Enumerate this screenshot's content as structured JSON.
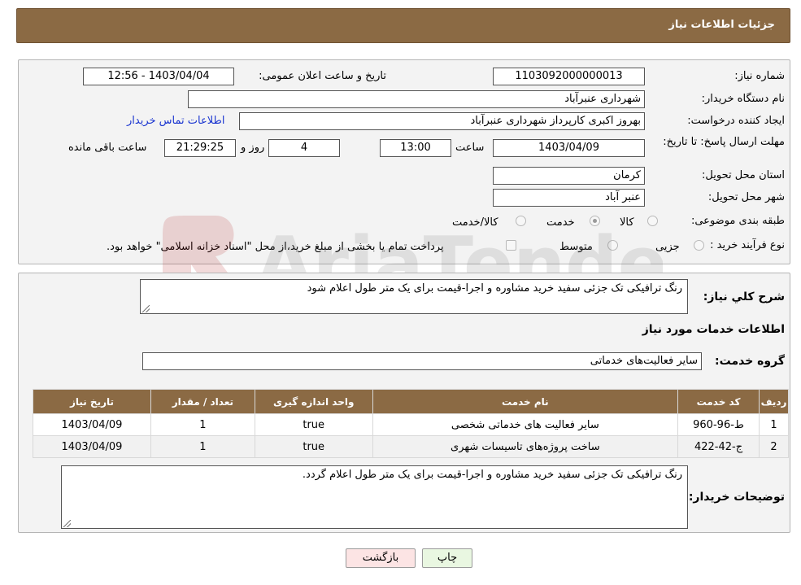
{
  "header": {
    "title": "جزئیات اطلاعات نیاز"
  },
  "form": {
    "need_number_label": "شماره نیاز:",
    "need_number": "1103092000000013",
    "announce_label": "تاریخ و ساعت اعلان عمومی:",
    "announce_value": "1403/04/04 - 12:56",
    "buyer_org_label": "نام دستگاه خریدار:",
    "buyer_org": "شهرداری عنبرآباد",
    "creator_label": "ایجاد کننده درخواست:",
    "creator": "بهروز اکبری کارپرداز شهرداری عنبرآباد",
    "contact_link": "اطلاعات تماس خریدار",
    "deadline_label": "مهلت ارسال پاسخ: تا تاریخ:",
    "deadline_date": "1403/04/09",
    "time_label": "ساعت",
    "deadline_time": "13:00",
    "days_value": "4",
    "days_label": "روز و",
    "remaining_time": "21:29:25",
    "remaining_label": "ساعت باقی مانده",
    "province_label": "استان محل تحویل:",
    "province": "کرمان",
    "city_label": "شهر محل تحویل:",
    "city": "عنبر آباد",
    "category_label": "طبقه بندی موضوعی:",
    "category_options": [
      "کالا",
      "خدمت",
      "کالا/خدمت"
    ],
    "category_selected": "خدمت",
    "process_label": "نوع فرآیند خرید :",
    "process_options": [
      "جزیی",
      "متوسط"
    ],
    "process_note": "پرداخت تمام یا بخشی از مبلغ خرید،از محل \"اسناد خزانه اسلامی\" خواهد بود."
  },
  "details": {
    "summary_label": "شرح کلي نياز:",
    "summary": "رنگ ترافیکی تک جزئی سفید خرید مشاوره و اجرا-قیمت برای یک متر طول اعلام شود",
    "services_title": "اطلاعات خدمات مورد نیاز",
    "service_group_label": "گروه خدمت:",
    "service_group": "سایر فعالیت‌های خدماتی",
    "table": {
      "headers": [
        "ردیف",
        "کد خدمت",
        "نام خدمت",
        "واحد اندازه گیری",
        "تعداد / مقدار",
        "تاریخ نیاز"
      ],
      "rows": [
        [
          "1",
          "ط-96-960",
          "سایر فعالیت های خدماتی شخصی",
          "true",
          "1",
          "1403/04/09"
        ],
        [
          "2",
          "ج-42-422",
          "ساخت پروژه‌های تاسیسات شهری",
          "true",
          "1",
          "1403/04/09"
        ]
      ]
    },
    "buyer_notes_label": "توضیحات خریدار:",
    "buyer_notes": "رنگ ترافیکی تک جزئی سفید خرید مشاوره و اجرا-قیمت برای یک متر طول اعلام گردد."
  },
  "buttons": {
    "print": "چاپ",
    "back": "بازگشت"
  },
  "watermark": {
    "text": "AriaTender.net"
  },
  "colors": {
    "header_bg": "#8b6a44",
    "link": "#1a35d0",
    "back_btn": "#fce4e4",
    "print_btn": "#e9f7e1"
  }
}
